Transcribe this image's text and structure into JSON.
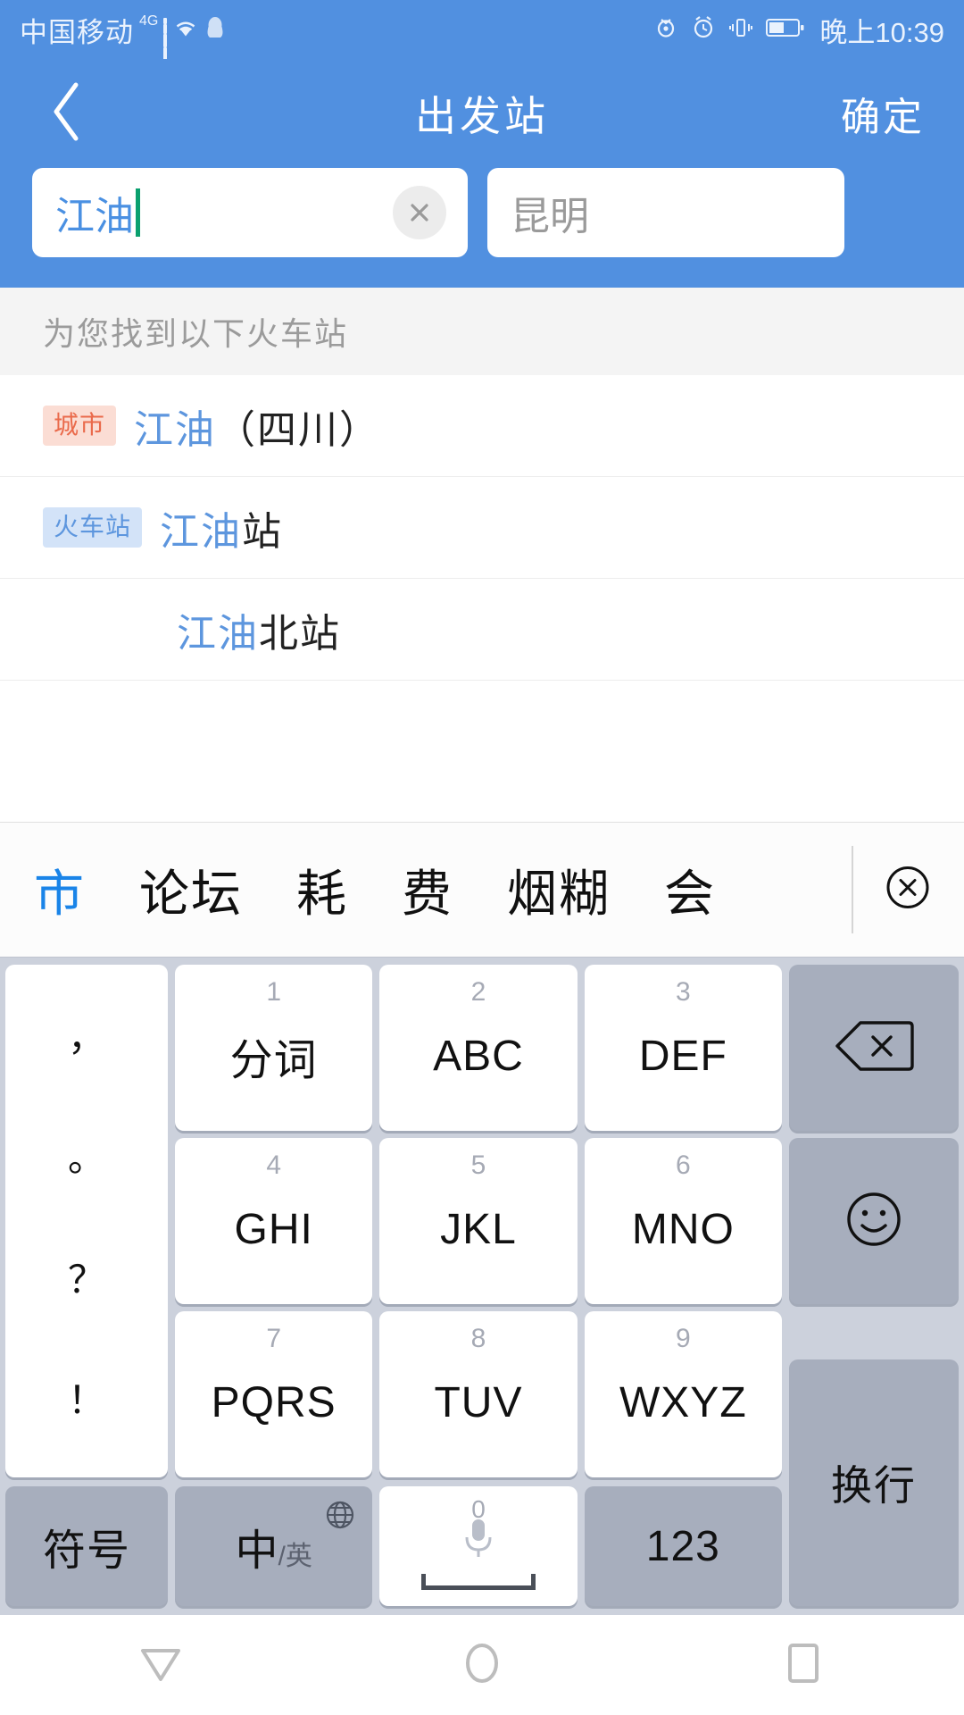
{
  "status_bar": {
    "carrier": "中国移动",
    "network": "4G",
    "time": "晚上10:39",
    "icons": [
      "signal-bars-icon",
      "wifi-icon",
      "qq-icon",
      "eye-icon",
      "alarm-icon",
      "vibrate-icon",
      "battery-icon"
    ]
  },
  "nav": {
    "back_icon": "chevron-left-icon",
    "title": "出发站",
    "action_label": "确定"
  },
  "search": {
    "from_value": "江油",
    "from_clear_icon": "close-circle-icon",
    "to_placeholder": "昆明"
  },
  "results": {
    "header": "为您找到以下火车站",
    "rows": [
      {
        "badge": "城市",
        "badge_type": "city",
        "highlight": "江油",
        "rest": "（四川）"
      },
      {
        "badge": "火车站",
        "badge_type": "station",
        "highlight": "江油",
        "rest": "站"
      },
      {
        "badge": "",
        "badge_type": "none",
        "highlight": "江油",
        "rest": "北站"
      }
    ]
  },
  "keyboard": {
    "candidates": [
      {
        "text": "市",
        "selected": true
      },
      {
        "text": "论坛",
        "selected": false
      },
      {
        "text": "耗",
        "selected": false
      },
      {
        "text": "费",
        "selected": false
      },
      {
        "text": "烟糊",
        "selected": false
      },
      {
        "text": "会",
        "selected": false
      }
    ],
    "candidate_close_icon": "close-circle-icon",
    "punctuation": [
      "，",
      "。",
      "？",
      "！"
    ],
    "keys": [
      {
        "num": "1",
        "label": "分词"
      },
      {
        "num": "2",
        "label": "ABC"
      },
      {
        "num": "3",
        "label": "DEF"
      },
      {
        "num": "4",
        "label": "GHI"
      },
      {
        "num": "5",
        "label": "JKL"
      },
      {
        "num": "6",
        "label": "MNO"
      },
      {
        "num": "7",
        "label": "PQRS"
      },
      {
        "num": "8",
        "label": "TUV"
      },
      {
        "num": "9",
        "label": "WXYZ"
      }
    ],
    "backspace_icon": "backspace-icon",
    "emoji_icon": "smiley-icon",
    "enter_label": "换行",
    "symbol_label": "符号",
    "lang_label_primary": "中",
    "lang_label_secondary": "/英",
    "lang_globe_icon": "globe-icon",
    "space_num": "0",
    "space_mic_icon": "microphone-icon",
    "numeric_label": "123"
  },
  "android_nav": {
    "back_icon": "triangle-back-icon",
    "home_icon": "circle-home-icon",
    "recents_icon": "square-recents-icon"
  },
  "colors": {
    "brand_blue": "#5190e0",
    "link_blue": "#5d96de",
    "city_badge_bg": "#fbddd4",
    "city_badge_fg": "#ea6a4b",
    "station_badge_bg": "#d3e3f8",
    "station_badge_fg": "#5d96de",
    "caret_green": "#0aa06e",
    "keyboard_bg": "#ccd1dc"
  }
}
